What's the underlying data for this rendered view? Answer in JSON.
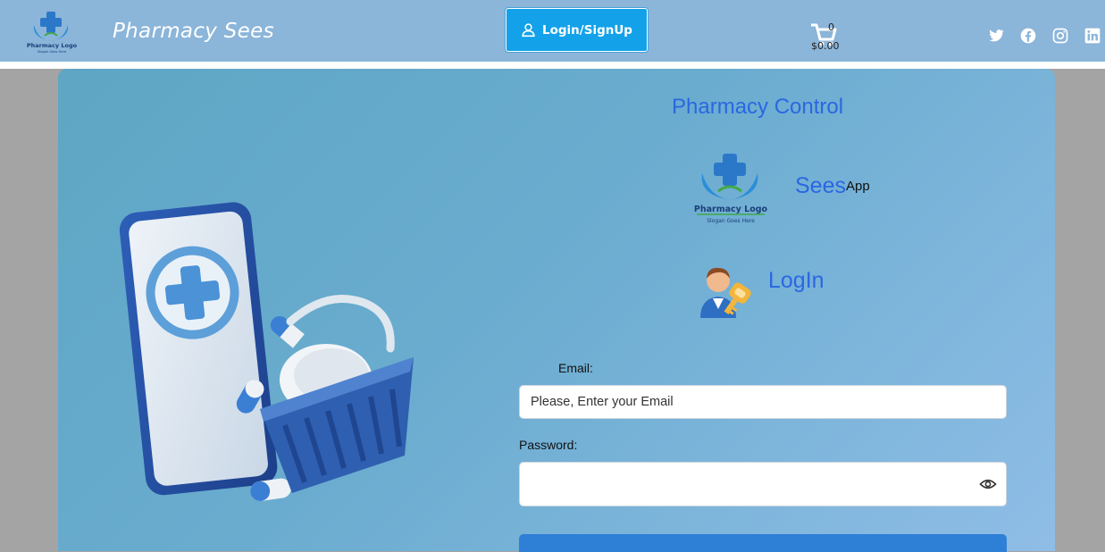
{
  "header": {
    "logo_icon": "pharmacy-logo-icon",
    "logo_text": "Pharmacy Logo",
    "logo_slogan": "Slogan Goes Here",
    "brand": "Pharmacy Sees",
    "login_button": "Login/SignUp",
    "cart": {
      "icon": "shopping-cart-icon",
      "count": "0",
      "total": "$0.00"
    },
    "social": [
      "twitter-icon",
      "facebook-icon",
      "instagram-icon",
      "linkedin-icon"
    ]
  },
  "panel": {
    "title": "Pharmacy Control",
    "logo_text": "Pharmacy Logo",
    "logo_slogan": "Slogan Goes Here",
    "app_name": "Sees",
    "app_suffix": "App",
    "login_heading": "LogIn"
  },
  "form": {
    "email_label": "Email:",
    "email_placeholder": "Please, Enter your Email",
    "email_value": "",
    "password_label": "Password:",
    "password_value": ""
  },
  "colors": {
    "accent": "#2a67e2",
    "button": "#13a2ea",
    "topbar": "#8bb5d9"
  }
}
